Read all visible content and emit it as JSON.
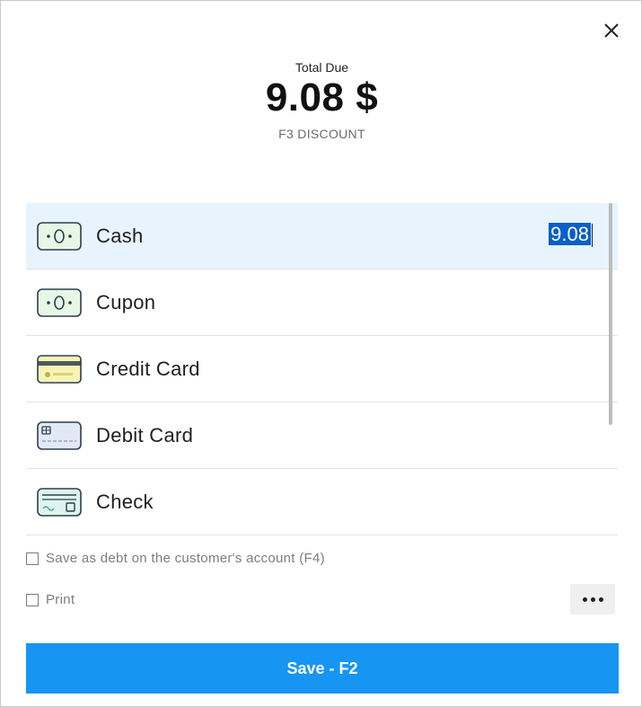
{
  "header": {
    "total_label": "Total Due",
    "total_amount": "9.08 $",
    "discount_label": "F3 DISCOUNT"
  },
  "payment_methods": [
    {
      "label": "Cash",
      "icon": "cash-icon",
      "amount": "9.08",
      "selected": true
    },
    {
      "label": "Cupon",
      "icon": "coupon-icon",
      "amount": "",
      "selected": false
    },
    {
      "label": "Credit Card",
      "icon": "credit-card-icon",
      "amount": "",
      "selected": false
    },
    {
      "label": "Debit Card",
      "icon": "debit-card-icon",
      "amount": "",
      "selected": false
    },
    {
      "label": "Check",
      "icon": "check-icon",
      "amount": "",
      "selected": false
    }
  ],
  "options": {
    "save_as_debt_label": "Save as debt on the customer's account (F4)",
    "save_as_debt_checked": false,
    "print_label": "Print",
    "print_checked": false
  },
  "footer": {
    "save_label": "Save - F2"
  },
  "colors": {
    "accent": "#1795f3",
    "selected_row": "#e8f4fd",
    "selection_highlight": "#0a5fc8",
    "cash_icon_bg": "#e6f7e6",
    "credit_icon_bg": "#f7f3b5",
    "debit_icon_bg": "#e3e8f7",
    "check_icon_bg": "#dff4ec"
  }
}
